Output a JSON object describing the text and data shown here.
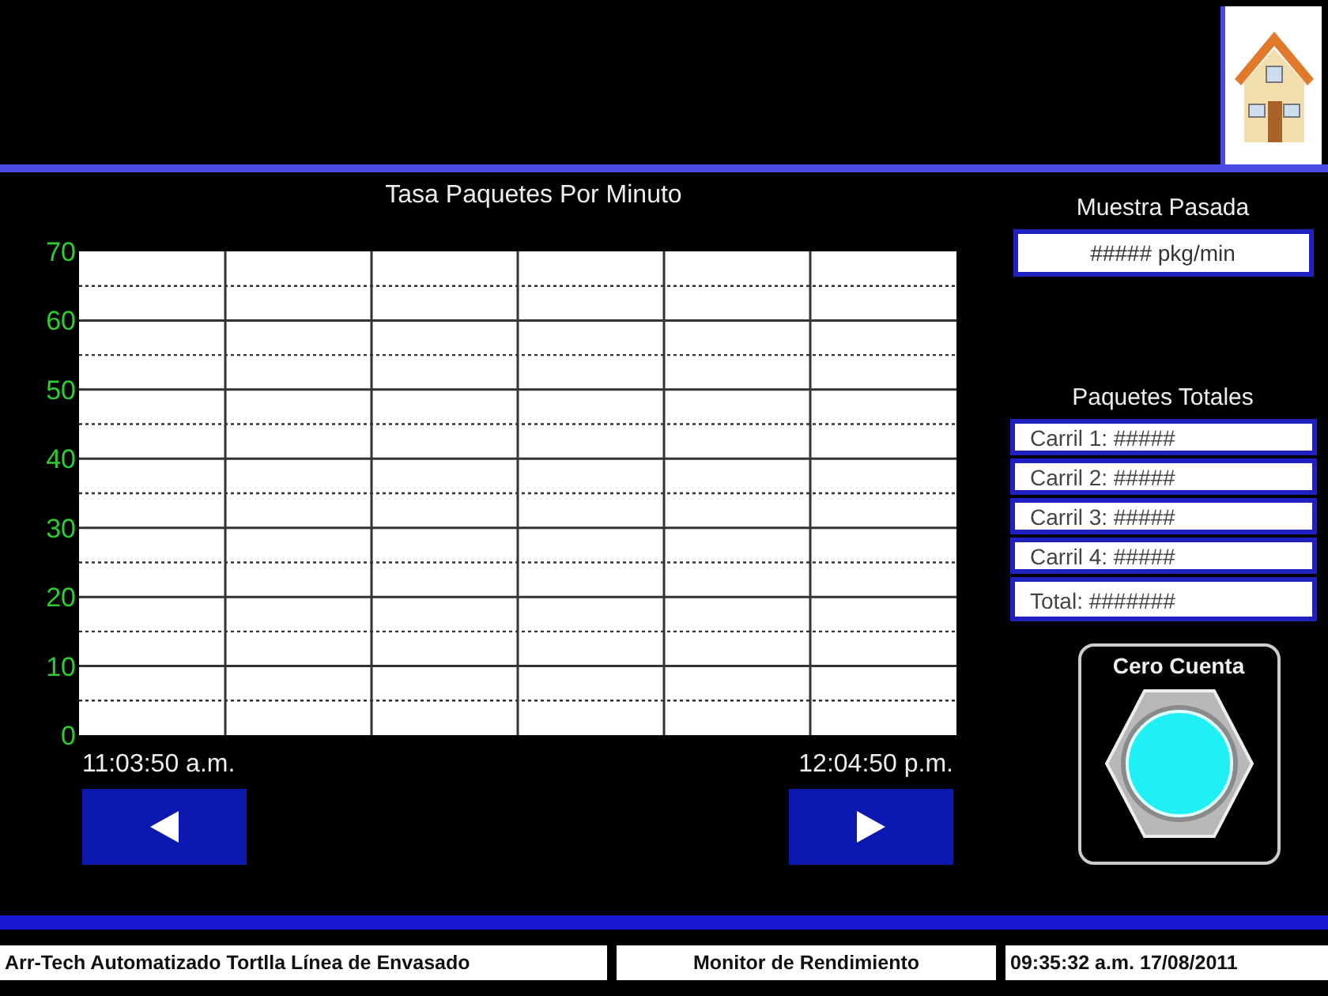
{
  "chart": {
    "chart_data": {
      "type": "line",
      "title": "Tasa Paquetes Por Minuto",
      "ylim": [
        0,
        70
      ],
      "yticks": [
        0,
        10,
        20,
        30,
        40,
        50,
        60,
        70
      ],
      "grid": true,
      "categories": [
        "11:03:50 a.m.",
        "12:04:50 p.m."
      ]
    }
  },
  "last_sample": {
    "label": "Muestra Pasada",
    "value": "##### pkg/min"
  },
  "totals": {
    "label": "Paquetes Totales",
    "rows": [
      "Carril 1: #####",
      "Carril 2: #####",
      "Carril 3: #####",
      "Carril 4: #####",
      "Total: #######"
    ]
  },
  "reset": {
    "label": "Cero Cuenta"
  },
  "status_bar": [
    "Arr-Tech Automatizado Tortlla Línea de Envasado",
    "Monitor de Rendimiento",
    "09:35:32 a.m. 17/08/2011"
  ]
}
